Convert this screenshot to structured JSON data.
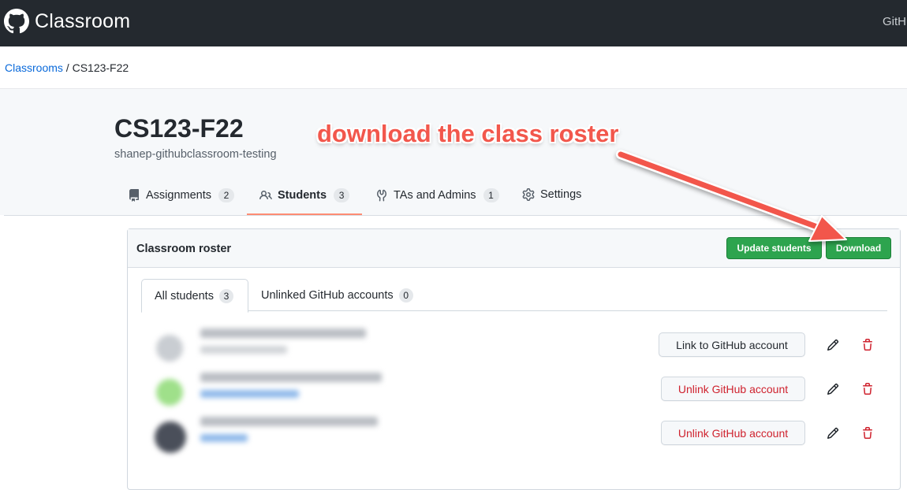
{
  "header": {
    "brand": "Classroom",
    "right_text": "GitHub"
  },
  "breadcrumb": {
    "parent": "Classrooms",
    "separator": "/",
    "current": "CS123-F22"
  },
  "classroom": {
    "title": "CS123-F22",
    "org": "shanep-githubclassroom-testing"
  },
  "tabs": [
    {
      "label": "Assignments",
      "count": "2",
      "icon": "repo-icon"
    },
    {
      "label": "Students",
      "count": "3",
      "icon": "people-icon",
      "active": true
    },
    {
      "label": "TAs and Admins",
      "count": "1",
      "icon": "tools-icon"
    },
    {
      "label": "Settings",
      "icon": "gear-icon"
    }
  ],
  "roster": {
    "title": "Classroom roster",
    "update_label": "Update students",
    "download_label": "Download",
    "subtabs": [
      {
        "label": "All students",
        "count": "3",
        "active": true
      },
      {
        "label": "Unlinked GitHub accounts",
        "count": "0"
      }
    ],
    "rows": [
      {
        "action": "Link to GitHub account",
        "type": "link"
      },
      {
        "action": "Unlink GitHub account",
        "type": "unlink"
      },
      {
        "action": "Unlink GitHub account",
        "type": "unlink"
      }
    ]
  },
  "annotation": {
    "text": "download the class roster",
    "color": "#f2574c"
  },
  "colors": {
    "topbar": "#24292f",
    "primary_button": "#2da44e",
    "danger": "#cf222e",
    "active_tab": "#fd8c73"
  }
}
